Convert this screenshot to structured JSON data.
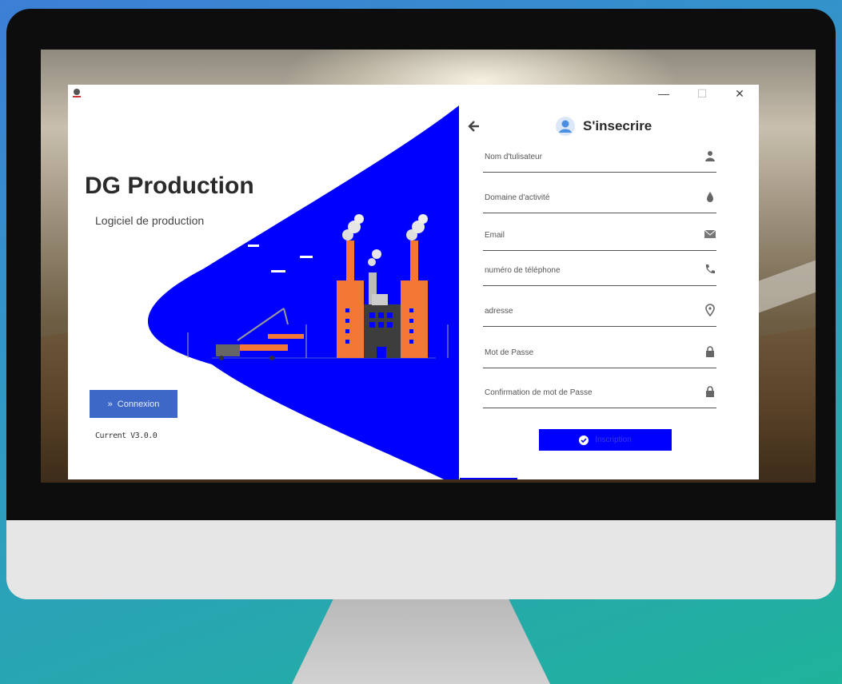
{
  "window": {
    "minimize": "—",
    "maximize": "☐",
    "close": "✕"
  },
  "brand": {
    "title": "DG Production",
    "subtitle": "Logiciel de production"
  },
  "sidebar": {
    "connexion_label": "Connexion",
    "version": "Current V3.0.0"
  },
  "form": {
    "title": "S'insecrire",
    "fields": [
      {
        "label": "Nom d'tulisateur",
        "icon": "user-icon"
      },
      {
        "label": "Domaine d'activité",
        "icon": "drop-icon"
      },
      {
        "label": "Email",
        "icon": "envelope-icon"
      },
      {
        "label": "numéro de téléphone",
        "icon": "phone-icon"
      },
      {
        "label": "adresse",
        "icon": "map-pin-icon"
      },
      {
        "label": "Mot de Passe",
        "icon": "lock-icon"
      },
      {
        "label": "Confirmation de mot de Passe",
        "icon": "lock-icon"
      }
    ],
    "submit_label": "Inscription"
  },
  "colors": {
    "accent_blue": "#0000ff",
    "connexion_blue": "#3e68c7",
    "factory_orange": "#f37735",
    "factory_gray": "#3d3d3d"
  }
}
